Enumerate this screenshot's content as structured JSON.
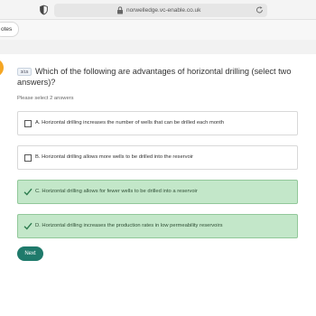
{
  "browser": {
    "url": "norwelledge.vc-enable.co.uk",
    "icons": {
      "privacy": "shield-icon",
      "lock": "lock-icon",
      "reload": "reload-icon"
    }
  },
  "toolbar": {
    "notes_label": "otes"
  },
  "question": {
    "counter": "3/15",
    "text": "Which of the following are advantages of horizontal drilling (select two answers)?",
    "instruction": "Please select 2 answers"
  },
  "options": [
    {
      "label": "A. Horizontal drilling increases the number of wells that can be drilled each month",
      "selected": false
    },
    {
      "label": "B. Horizontal drilling allows more wells to be drilled into the reservoir",
      "selected": false
    },
    {
      "label": "C. Horizontal drilling allows for fewer wells to be drilled into a reservoir",
      "selected": true
    },
    {
      "label": "D. Horizontal drilling increases the production rates in low permeability reservoirs",
      "selected": true
    }
  ],
  "actions": {
    "next_label": "Next"
  },
  "colors": {
    "accent": "#1f7a6b",
    "selected_bg": "#c3e7c9",
    "selected_border": "#92c89a",
    "check": "#2e7d4f",
    "marker": "#f5a623"
  }
}
